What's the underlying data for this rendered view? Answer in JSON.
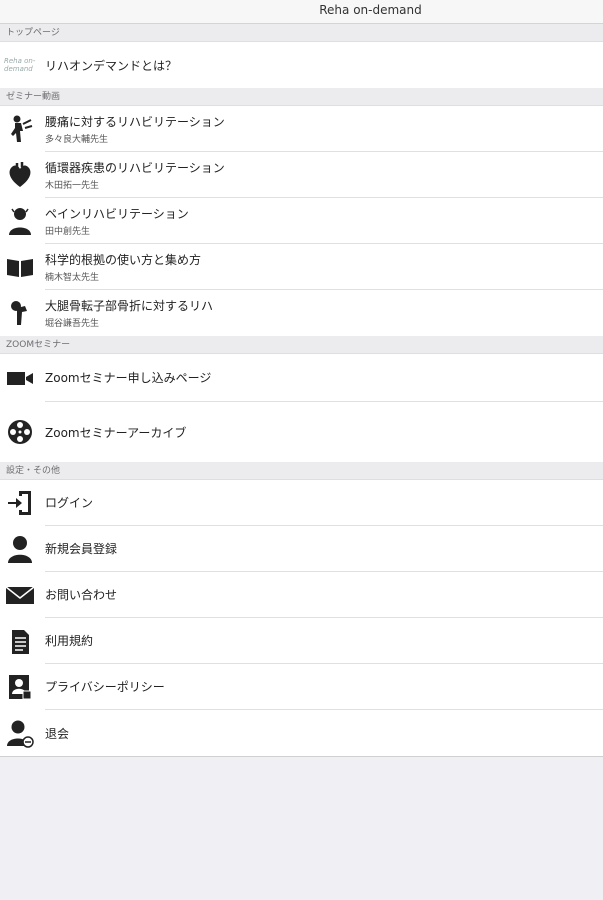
{
  "navbar": {
    "title": "Reha on-demand"
  },
  "sections": {
    "top": {
      "header": "トップページ",
      "items": [
        {
          "label": "リハオンデマンドとは？",
          "icon": "reha-logo-icon",
          "logo_text": "Reha on-demand"
        }
      ]
    },
    "seminar": {
      "header": "ゼミナー動画",
      "items": [
        {
          "label": "腰痛に対するリハビリテーション",
          "sub": "多々良大輔先生",
          "icon": "back-pain-figure-icon"
        },
        {
          "label": "循環器疾患のリハビリテーション",
          "sub": "木田拓一先生",
          "icon": "heart-icon"
        },
        {
          "label": "ペインリハビリテーション",
          "sub": "田中創先生",
          "icon": "person-pain-icon"
        },
        {
          "label": "科学的根拠の使い方と集め方",
          "sub": "楠木智太先生",
          "icon": "open-book-icon"
        },
        {
          "label": "大腿骨転子部骨折に対するリハ",
          "sub": "堀谷謙吾先生",
          "icon": "femur-bone-icon"
        }
      ]
    },
    "zoom": {
      "header": "ZOOMセミナー",
      "items": [
        {
          "label": "Zoomセミナー申し込みページ",
          "icon": "video-camera-icon"
        },
        {
          "label": "Zoomセミナーアーカイブ",
          "icon": "film-reel-icon"
        }
      ]
    },
    "settings": {
      "header": "設定・その他",
      "items": [
        {
          "label": "ログイン",
          "icon": "login-door-icon"
        },
        {
          "label": "新規会員登録",
          "icon": "user-icon"
        },
        {
          "label": "お問い合わせ",
          "icon": "envelope-icon"
        },
        {
          "label": "利用規約",
          "icon": "document-icon"
        },
        {
          "label": "プライバシーポリシー",
          "icon": "privacy-id-icon"
        },
        {
          "label": "退会",
          "icon": "user-remove-icon"
        }
      ]
    }
  }
}
